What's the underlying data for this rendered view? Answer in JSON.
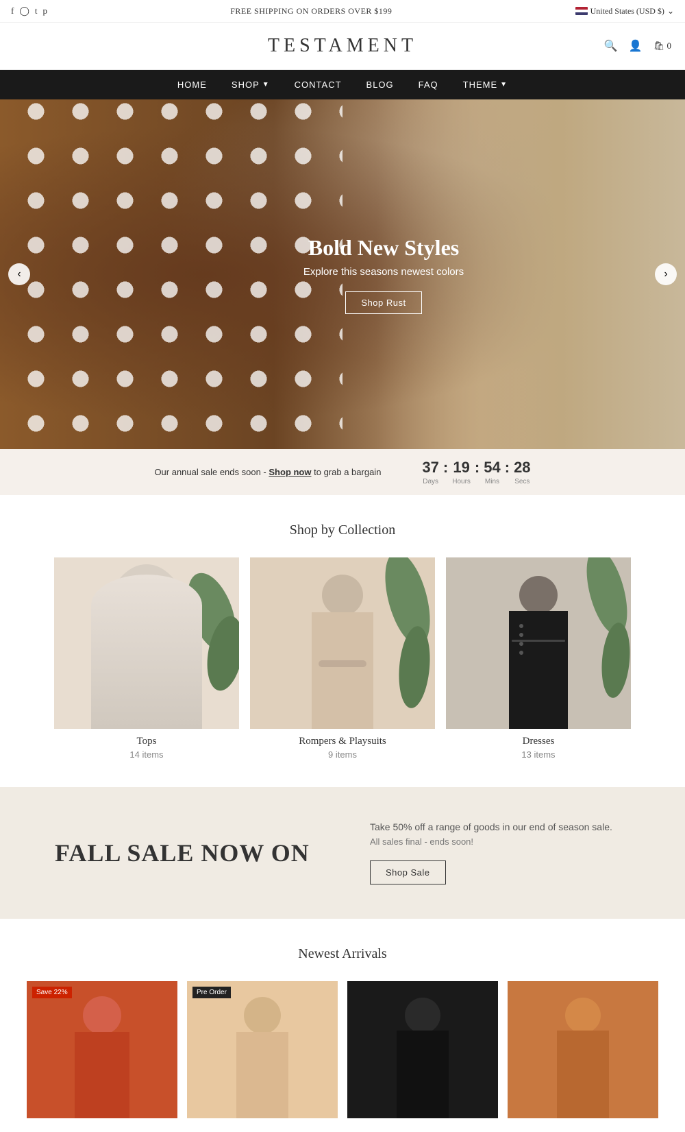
{
  "topbar": {
    "shipping_text": "FREE SHIPPING ON ORDERS OVER $199",
    "country": "United States (USD $)",
    "social": [
      "fb",
      "ig",
      "tw",
      "pt"
    ]
  },
  "header": {
    "logo": "TESTAMENT",
    "cart_count": "0"
  },
  "nav": {
    "items": [
      {
        "label": "HOME",
        "has_dropdown": false
      },
      {
        "label": "SHOP",
        "has_dropdown": true
      },
      {
        "label": "CONTACT",
        "has_dropdown": false
      },
      {
        "label": "BLOG",
        "has_dropdown": false
      },
      {
        "label": "FAQ",
        "has_dropdown": false
      },
      {
        "label": "THEME",
        "has_dropdown": true
      }
    ]
  },
  "hero": {
    "title": "Bold New Styles",
    "subtitle": "Explore this seasons newest colors",
    "cta_label": "Shop Rust",
    "prev_label": "‹",
    "next_label": "›"
  },
  "sale_ticker": {
    "text": "Our annual sale ends soon -",
    "link_text": "Shop now",
    "suffix": "to grab a bargain",
    "countdown": {
      "days": "37",
      "hours": "19",
      "mins": "54",
      "secs": "28",
      "labels": [
        "Days",
        "Hours",
        "Mins",
        "Secs"
      ]
    }
  },
  "collections_section": {
    "title": "Shop by Collection",
    "items": [
      {
        "name": "Tops",
        "count": "14 items"
      },
      {
        "name": "Rompers & Playsuits",
        "count": "9 items"
      },
      {
        "name": "Dresses",
        "count": "13 items"
      }
    ]
  },
  "fall_sale": {
    "title": "FALL SALE NOW ON",
    "description": "Take 50% off a range of goods in our end of season sale.",
    "sub_description": "All sales final - ends soon!",
    "cta_label": "Shop Sale"
  },
  "newest_arrivals": {
    "title": "Newest Arrivals",
    "products": [
      {
        "badge": "Save 22%",
        "badge_type": "sale"
      },
      {
        "badge": "Pre Order",
        "badge_type": "preorder"
      },
      {},
      {}
    ]
  }
}
